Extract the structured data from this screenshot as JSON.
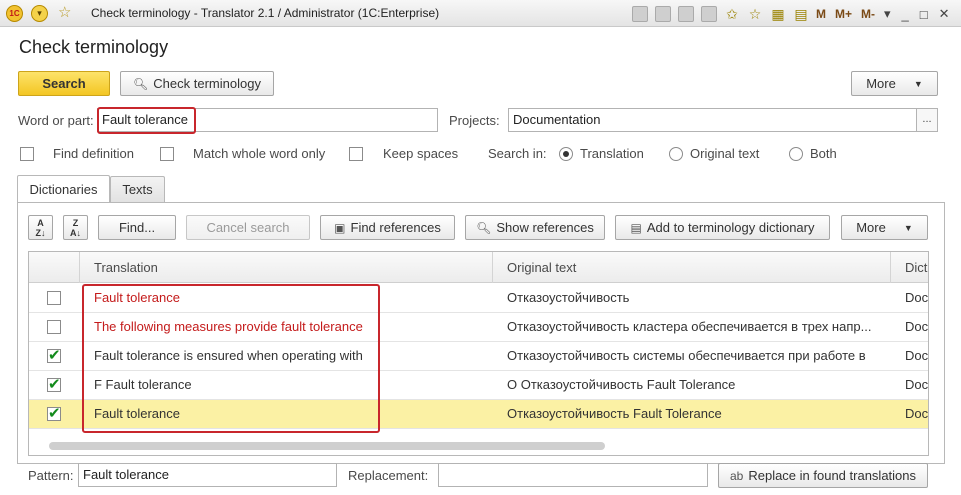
{
  "window": {
    "title": "Check terminology - Translator 2.1 / Administrator  (1C:Enterprise)",
    "logo_text": "1C",
    "m_buttons": [
      "M",
      "M+",
      "M-"
    ]
  },
  "form": {
    "title": "Check terminology",
    "search_label": "Search",
    "check_terminology_label": "Check terminology",
    "more_label": "More",
    "word_label": "Word or part:",
    "word_value": "Fault tolerance",
    "projects_label": "Projects:",
    "projects_value": "Documentation",
    "choose_label": "...",
    "options": {
      "find_definition": "Find definition",
      "match_whole_word": "Match whole word only",
      "keep_spaces": "Keep spaces"
    },
    "search_in_label": "Search in:",
    "search_in": {
      "translation": "Translation",
      "original_text": "Original text",
      "both": "Both",
      "selected": "translation"
    }
  },
  "tabs": [
    {
      "label": "Dictionaries",
      "active": true
    },
    {
      "label": "Texts",
      "active": false
    }
  ],
  "toolbar": {
    "sort_asc": "A Z",
    "sort_desc": "Z A",
    "find_label": "Find...",
    "cancel_search_label": "Cancel search",
    "find_references_label": "Find references",
    "show_references_label": "Show references",
    "add_to_dictionary_label": "Add to terminology dictionary",
    "more_label": "More"
  },
  "grid": {
    "columns": [
      "Translation",
      "Original text",
      "Dict"
    ],
    "rows": [
      {
        "checked": false,
        "translation": "Fault tolerance",
        "original": "Отказоустойчивость",
        "dict": "Doc",
        "highlight_red": true,
        "selected": false
      },
      {
        "checked": false,
        "translation": "The following measures provide fault tolerance",
        "original": "Отказоустойчивость кластера обеспечивается в трех напр...",
        "dict": "Doc",
        "highlight_red": true,
        "selected": false
      },
      {
        "checked": true,
        "translation": "Fault tolerance is ensured when operating with",
        "original": "Отказоустойчивость системы обеспечивается при работе в",
        "dict": "Doc",
        "highlight_red": false,
        "selected": false
      },
      {
        "checked": true,
        "translation": "F Fault tolerance",
        "original": "О Отказоустойчивость Fault Tolerance",
        "dict": "Doc",
        "highlight_red": false,
        "selected": false
      },
      {
        "checked": true,
        "translation": "Fault tolerance",
        "original": "Отказоустойчивость Fault Tolerance",
        "dict": "Doc",
        "highlight_red": false,
        "selected": true
      }
    ]
  },
  "bottom": {
    "pattern_label": "Pattern:",
    "pattern_value": "Fault tolerance",
    "replacement_label": "Replacement:",
    "replacement_value": "",
    "replace_button_label": "Replace in found translations"
  },
  "colors": {
    "accent_yellow": "#f3c623",
    "selection_row": "#fbf1a4",
    "highlight_red": "#c41b1b",
    "check_green": "#138b1c"
  }
}
